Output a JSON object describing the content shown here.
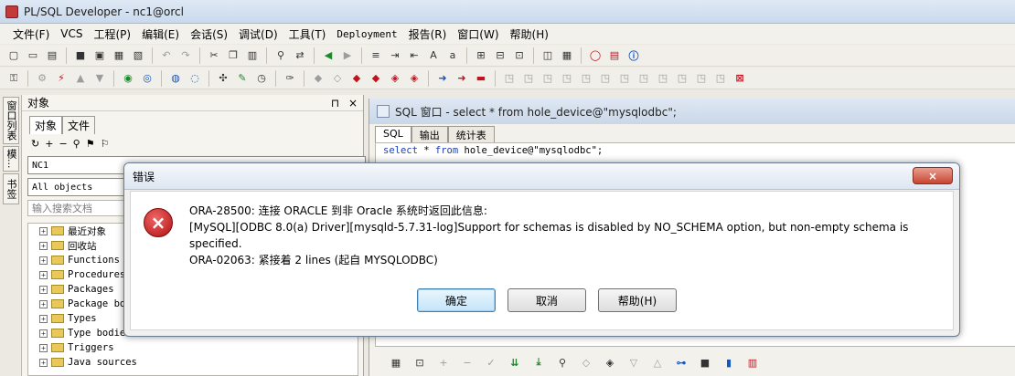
{
  "window": {
    "title": "PL/SQL Developer - nc1@orcl"
  },
  "menubar": {
    "items": [
      "文件(F)",
      "VCS",
      "工程(P)",
      "编辑(E)",
      "会话(S)",
      "调试(D)",
      "工具(T)",
      "Deployment",
      "报告(R)",
      "窗口(W)",
      "帮助(H)"
    ]
  },
  "side_tabs": {
    "t1": "窗口列表",
    "t2": "模...",
    "t3": "书签"
  },
  "object_panel": {
    "title": "对象",
    "pin": "⊓",
    "close": "×",
    "tabs": [
      "对象",
      "文件"
    ],
    "connection": "NC1",
    "filter": "All objects",
    "search_placeholder": "输入搜索文档",
    "tree": [
      "最近对象",
      "回收站",
      "Functions",
      "Procedures",
      "Packages",
      "Package bodies",
      "Types",
      "Type bodies",
      "Triggers",
      "Java sources"
    ]
  },
  "sql_window": {
    "title": "SQL 窗口 - select * from hole_device@\"mysqlodbc\";",
    "tabs": [
      "SQL",
      "输出",
      "统计表"
    ],
    "sql_keyword_select": "select",
    "sql_mid": " * ",
    "sql_keyword_from": "from",
    "sql_rest": " hole_device@\"mysqlodbc\";"
  },
  "dialog": {
    "title": "错误",
    "close_glyph": "×",
    "error_glyph": "×",
    "line1": "ORA-28500: 连接 ORACLE 到非 Oracle 系统时返回此信息:",
    "line2": "[MySQL][ODBC 8.0(a) Driver][mysqld-5.7.31-log]Support for schemas is disabled by NO_SCHEMA option, but non-empty schema is specified.",
    "line3": "ORA-02063: 紧接着 2 lines (起自 MYSQLODBC)",
    "ok_label": "确定",
    "cancel_label": "取消",
    "help_label": "帮助(H)"
  },
  "colors": {
    "error_red": "#c1121f",
    "title_blue": "#cad7e8",
    "keyword_blue": "#1b3fb5"
  }
}
